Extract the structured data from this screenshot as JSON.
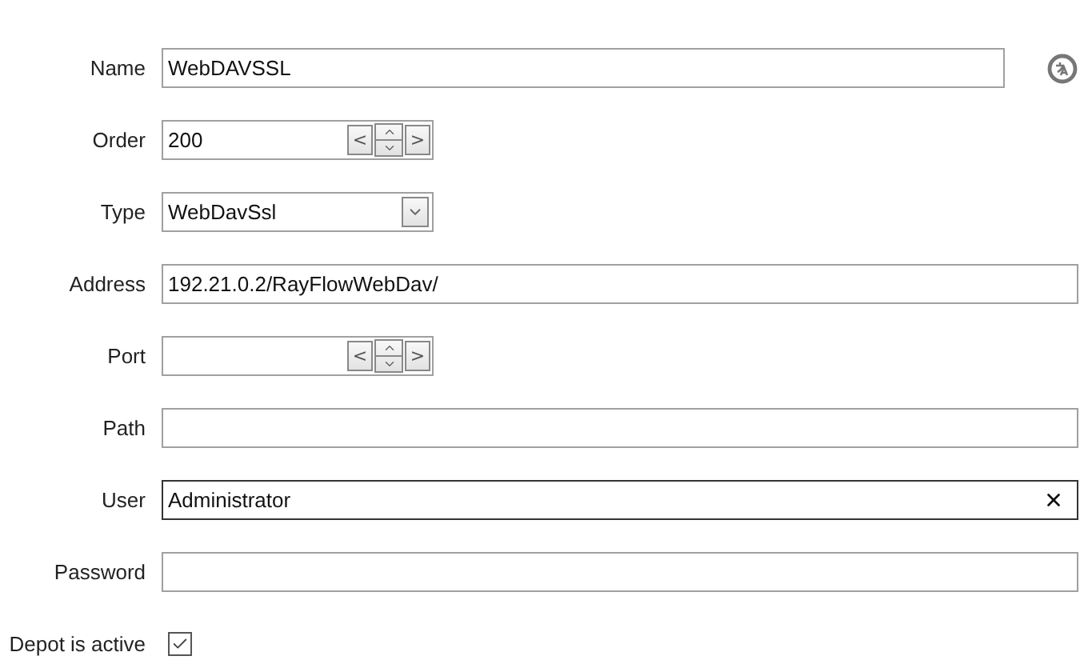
{
  "fields": [
    {
      "kind": "translatable_text",
      "label": "Name",
      "value": "WebDAVSSL",
      "focused": false
    },
    {
      "kind": "spinner",
      "label": "Order",
      "value": "200",
      "prev": "<",
      "next": ">"
    },
    {
      "kind": "dropdown",
      "label": "Type",
      "value": "WebDavSsl"
    },
    {
      "kind": "text",
      "label": "Address",
      "value": "192.21.0.2/RayFlowWebDav/",
      "focused": false
    },
    {
      "kind": "spinner",
      "label": "Port",
      "prev": "<",
      "next": ">"
    },
    {
      "kind": "text",
      "label": "Path",
      "focused": false
    },
    {
      "kind": "clearable_text",
      "label": "User",
      "value": "Administrator",
      "focused": true
    },
    {
      "kind": "password",
      "label": "Password"
    },
    {
      "kind": "checkbox",
      "label": "Depot is active",
      "checked": true
    }
  ]
}
